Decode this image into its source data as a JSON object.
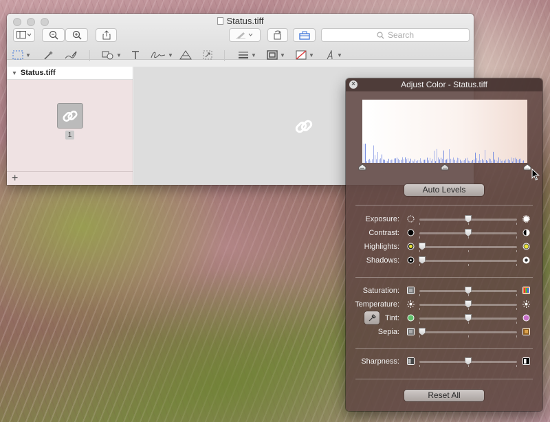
{
  "window": {
    "title": "Status.tiff",
    "search_placeholder": "Search"
  },
  "sidebar": {
    "header": "Status.tiff",
    "page_number": "1",
    "add_label": "+"
  },
  "panel": {
    "title": "Adjust Color - Status.tiff",
    "close_label": "×",
    "auto_levels": "Auto Levels",
    "reset_all": "Reset All",
    "sliders": [
      {
        "label": "Exposure:",
        "value": 0.5
      },
      {
        "label": "Contrast:",
        "value": 0.5
      },
      {
        "label": "Highlights:",
        "value": 0.0
      },
      {
        "label": "Shadows:",
        "value": 0.0
      },
      {
        "label": "Saturation:",
        "value": 0.5
      },
      {
        "label": "Temperature:",
        "value": 0.5
      },
      {
        "label": "Tint:",
        "value": 0.5
      },
      {
        "label": "Sepia:",
        "value": 0.0
      },
      {
        "label": "Sharpness:",
        "value": 0.5
      }
    ],
    "levels": {
      "black": 0.0,
      "mid": 0.5,
      "white": 1.0
    }
  },
  "colors": {
    "accent": "#3b73d9",
    "highlight_icon": "#e8e23a",
    "tint_left": "#5fbf6a",
    "tint_right": "#c770c7"
  }
}
